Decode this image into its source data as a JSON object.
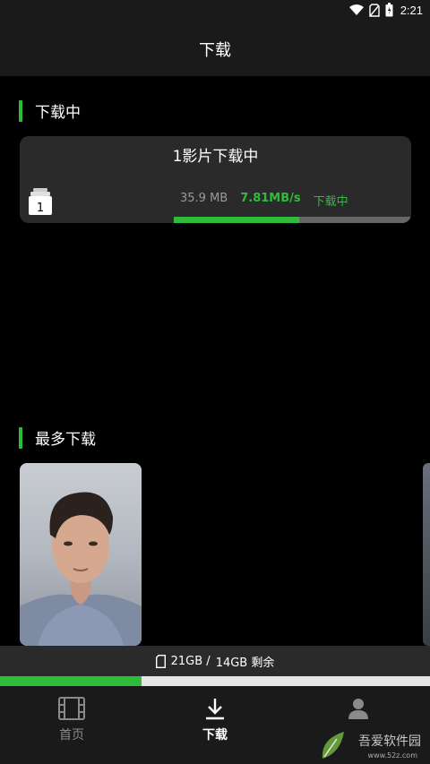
{
  "status_bar": {
    "time": "2:21"
  },
  "header": {
    "title": "下载"
  },
  "downloading": {
    "section_title": "下载中",
    "card": {
      "title": "1影片下载中",
      "count_badge": "1",
      "size": "35.9 MB",
      "speed": "7.81MB/s",
      "status": "下载中",
      "progress": 0.53
    }
  },
  "most_downloaded": {
    "section_title": "最多下载"
  },
  "storage": {
    "used": "21GB /",
    "total": "14GB 剩余",
    "progress": 0.33
  },
  "nav": {
    "items": [
      {
        "label": "首页"
      },
      {
        "label": "下载"
      }
    ]
  },
  "watermark": {
    "text": "吾爱软件园",
    "url": "www.52z.com"
  },
  "colors": {
    "accent": "#2ebd3b",
    "card": "#2a2a2a",
    "bar": "#1a1a1a"
  },
  "icons": [
    "wifi-icon",
    "no-sim-icon",
    "battery-icon",
    "file-stack-icon",
    "sd-card-icon",
    "film-icon",
    "download-icon",
    "user-icon"
  ]
}
